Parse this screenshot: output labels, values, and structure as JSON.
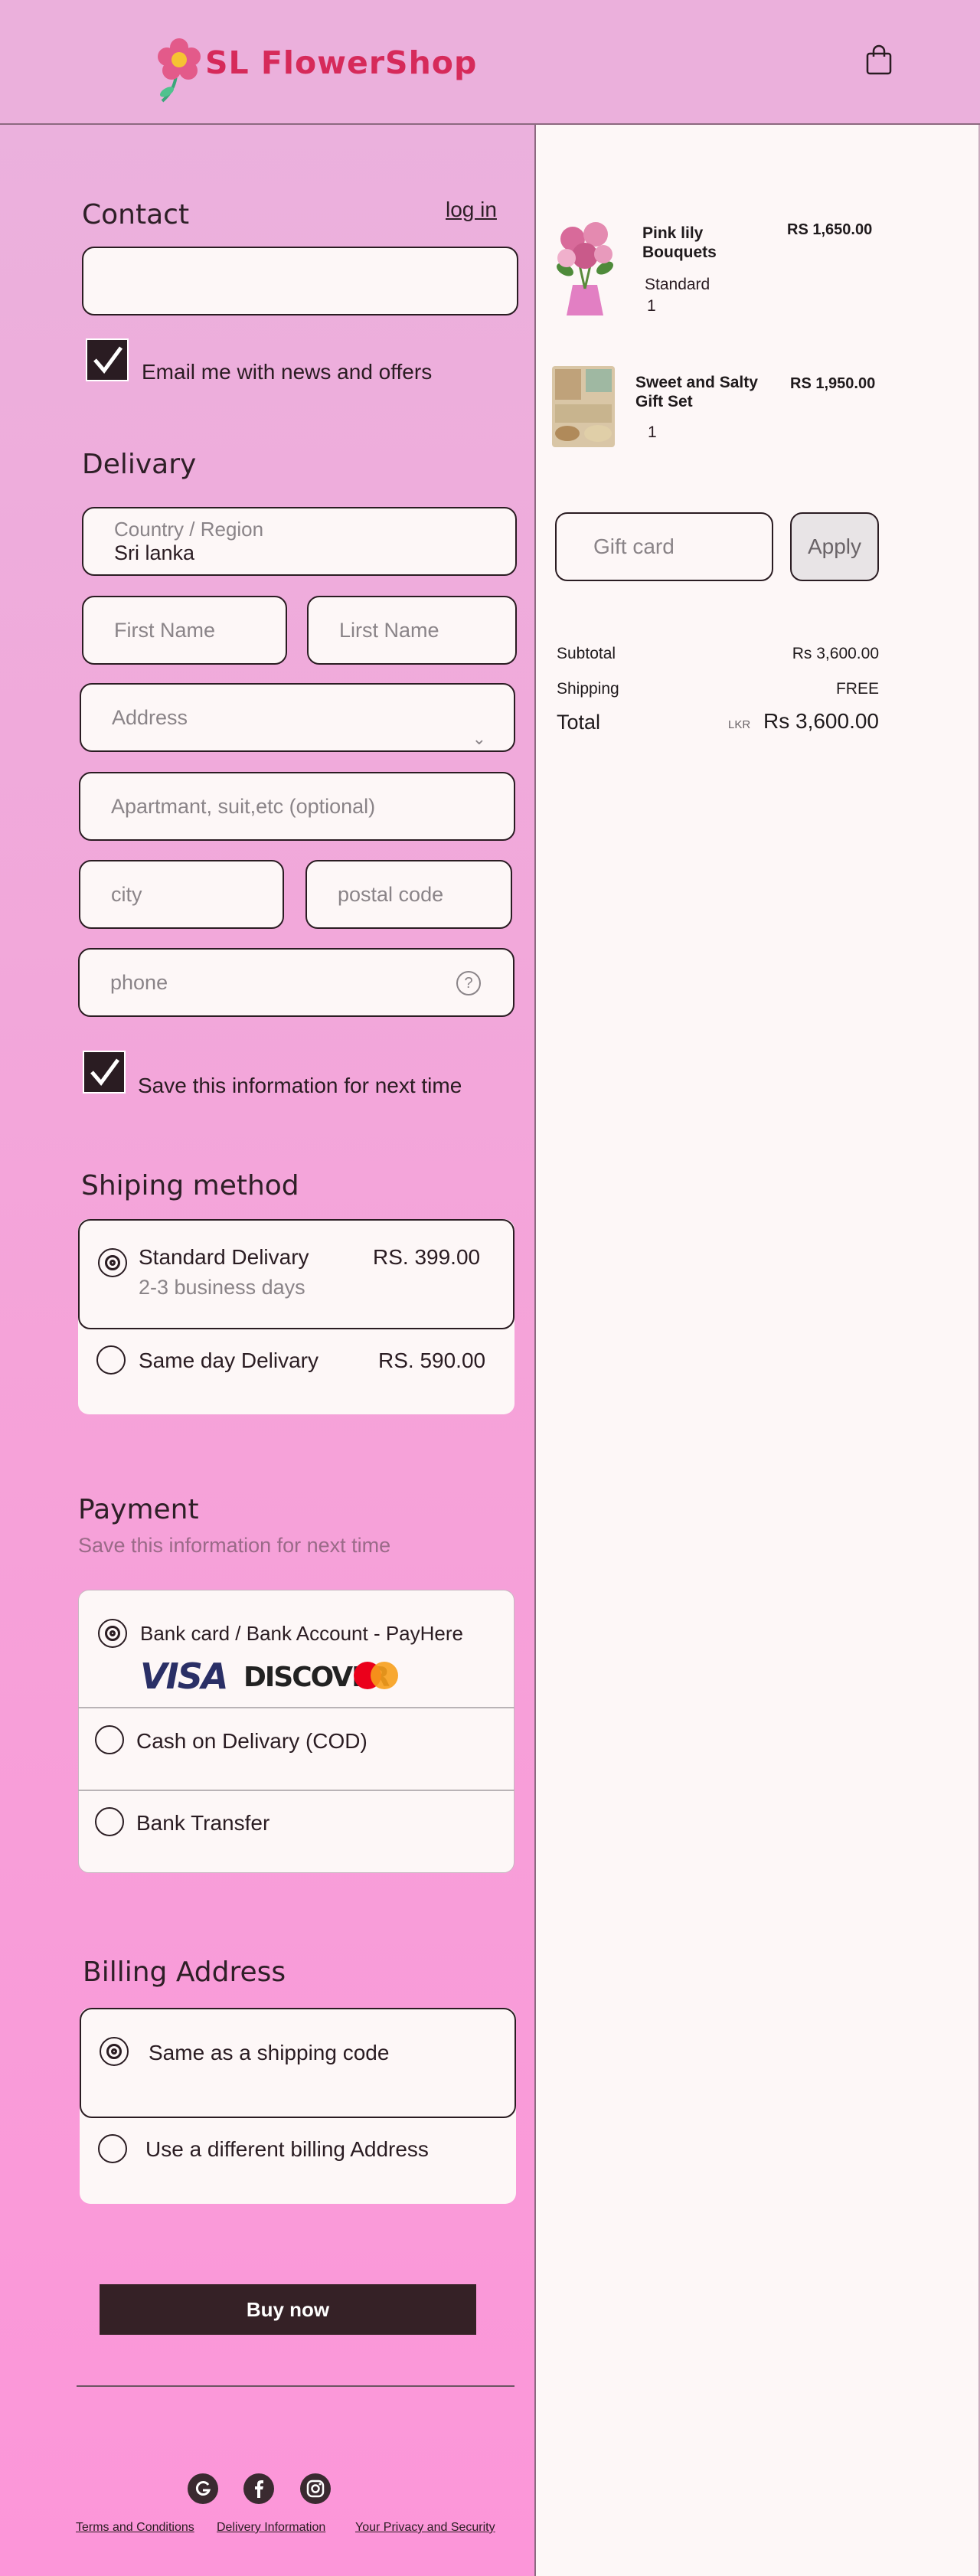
{
  "header": {
    "brand": "SL  FlowerShop",
    "cart_icon": "shopping-bag-icon"
  },
  "contact": {
    "title": "Contact",
    "login_link": "log in",
    "email_value": "",
    "newsletter_label": "Email me with news and offers",
    "newsletter_checked": true
  },
  "delivery": {
    "title": "Delivary",
    "country_label": "Country / Region",
    "country_value": "Sri lanka",
    "first_name_placeholder": "First Name",
    "last_name_placeholder": "Lirst Name",
    "address_placeholder": "Address",
    "apartment_placeholder": "Apartmant, suit,etc (optional)",
    "city_placeholder": "city",
    "postal_placeholder": "postal code",
    "phone_placeholder": "phone",
    "save_label": "Save this information for next time",
    "save_checked": true
  },
  "shipping": {
    "title": "Shiping method",
    "options": [
      {
        "label": "Standard Delivary",
        "price": "RS. 399.00",
        "sub": "2-3  business days",
        "selected": true
      },
      {
        "label": "Same day Delivary",
        "price": "RS. 590.00",
        "selected": false
      }
    ]
  },
  "payment": {
    "title": "Payment",
    "subtitle": "Save this information for next time",
    "options": [
      {
        "label": "Bank card / Bank Account - PayHere",
        "selected": true
      },
      {
        "label": "Cash on Delivary (COD)",
        "selected": false
      },
      {
        "label": "Bank Transfer",
        "selected": false
      }
    ],
    "card_logos": [
      "VISA",
      "DISCOVER",
      "mastercard"
    ]
  },
  "billing": {
    "title": "Billing Address",
    "options": [
      {
        "label": "Same as a shipping code",
        "selected": true
      },
      {
        "label": "Use a different  billing Address",
        "selected": false
      }
    ]
  },
  "buy_button": "Buy now",
  "footer": {
    "social": [
      "google-icon",
      "facebook-icon",
      "instagram-icon"
    ],
    "links": [
      "Terms and Conditions",
      "Delivery Information",
      "Your Privacy and Security"
    ]
  },
  "order": {
    "items": [
      {
        "name_line1": "Pink lily",
        "name_line2": "Bouquets",
        "price": "RS 1,650.00",
        "variant": "Standard",
        "qty": "1"
      },
      {
        "name_line1": "Sweet and Salty",
        "name_line2": "Gift Set",
        "price": "RS 1,950.00",
        "qty": "1"
      }
    ],
    "gift_card_placeholder": "Gift card",
    "apply_label": "Apply",
    "subtotal_label": "Subtotal",
    "subtotal_value": "Rs 3,600.00",
    "shipping_label": "Shipping",
    "shipping_value": "FREE",
    "total_label": "Total",
    "currency": "LKR",
    "total_value": "Rs 3,600.00"
  },
  "colors": {
    "header_bg": "#ebb0dc",
    "brand": "#d62a5a",
    "button_bg": "#352126",
    "panel_bg": "#fdf7f7"
  }
}
